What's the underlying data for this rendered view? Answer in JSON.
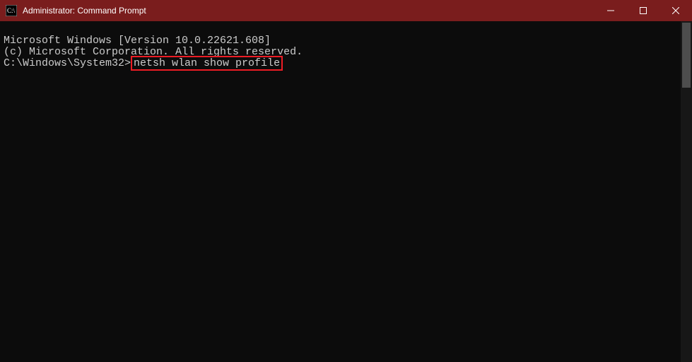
{
  "titlebar": {
    "title": "Administrator: Command Prompt"
  },
  "terminal": {
    "line1": "Microsoft Windows [Version 10.0.22621.608]",
    "line2": "(c) Microsoft Corporation. All rights reserved.",
    "prompt": "C:\\Windows\\System32>",
    "command": "netsh wlan show profile"
  },
  "colors": {
    "titlebar_bg": "#7a1d1d",
    "term_bg": "#0c0c0c",
    "term_fg": "#cccccc",
    "highlight_border": "#ed1c24"
  }
}
